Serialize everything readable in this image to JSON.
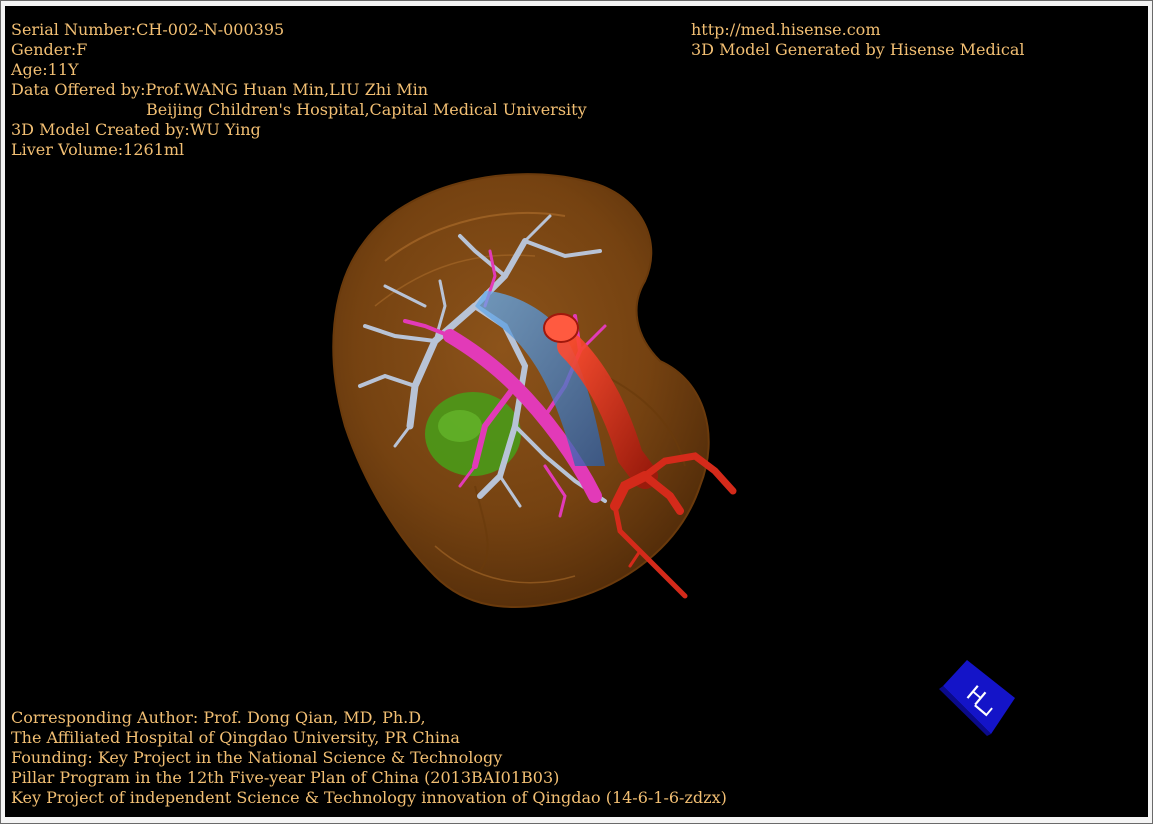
{
  "window": {
    "info": {
      "serial_number": "Serial Number:CH-002-N-000395",
      "gender": "Gender:F",
      "age": "Age:11Y",
      "data_offered_line1": "Data Offered by:Prof.WANG Huan Min,LIU Zhi Min",
      "data_offered_line2": "Beijing Children's Hospital,Capital Medical University",
      "model_created_by": "3D Model Created by:WU Ying",
      "liver_volume": "Liver Volume:1261ml"
    },
    "credit": {
      "url": "http://med.hisense.com",
      "generated_by": "3D Model Generated by Hisense Medical"
    },
    "footer": {
      "corresponding_author": "Corresponding Author: Prof. Dong Qian, MD, Ph.D,",
      "affiliation": "The Affiliated Hospital of Qingdao University, PR China",
      "founding": "Founding: Key Project in the National Science & Technology",
      "pillar_program": "Pillar Program in the 12th Five-year Plan of China (2013BAI01B03)",
      "key_project": "Key Project of independent Science & Technology innovation of Qingdao (14-6-1-6-zdzx)"
    },
    "orientation_cube": {
      "face_letter": "H",
      "side_letter": "L"
    }
  },
  "colors": {
    "background": "#000000",
    "text": "#f2bf73",
    "liver": "#8a4e14",
    "hepatic_vein": "#b8c3d6",
    "portal_vein": "#e23ab8",
    "vena_cava": "#4a8ed6",
    "artery": "#d42a1a",
    "gallbladder": "#4a9a18",
    "cube": "#1414c8"
  }
}
